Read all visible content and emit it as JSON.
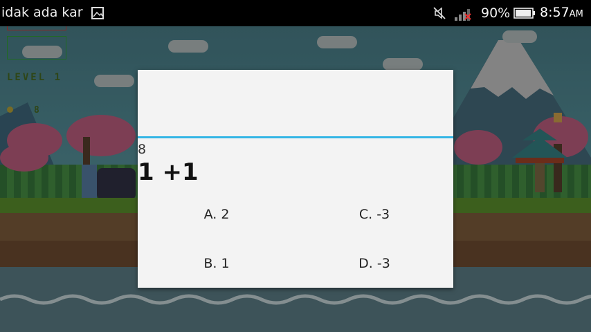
{
  "status_bar": {
    "notification": "idak ada kar",
    "battery_percent": "90%",
    "time": "8:57",
    "time_suffix": "AM",
    "icons": [
      "image-icon",
      "mute-icon",
      "signal-icon",
      "battery-icon"
    ]
  },
  "game": {
    "level_label": "LEVEL 1",
    "score": "8"
  },
  "dialog": {
    "question_number": "8",
    "question": "1 +1",
    "answers": [
      {
        "label": "A. 2"
      },
      {
        "label": "C. -3"
      },
      {
        "label": "B. 1"
      },
      {
        "label": "D. -3"
      }
    ]
  },
  "colors": {
    "accent": "#33b5e5",
    "dialog_bg": "#f3f3f3",
    "status_bar_bg": "#000000"
  }
}
